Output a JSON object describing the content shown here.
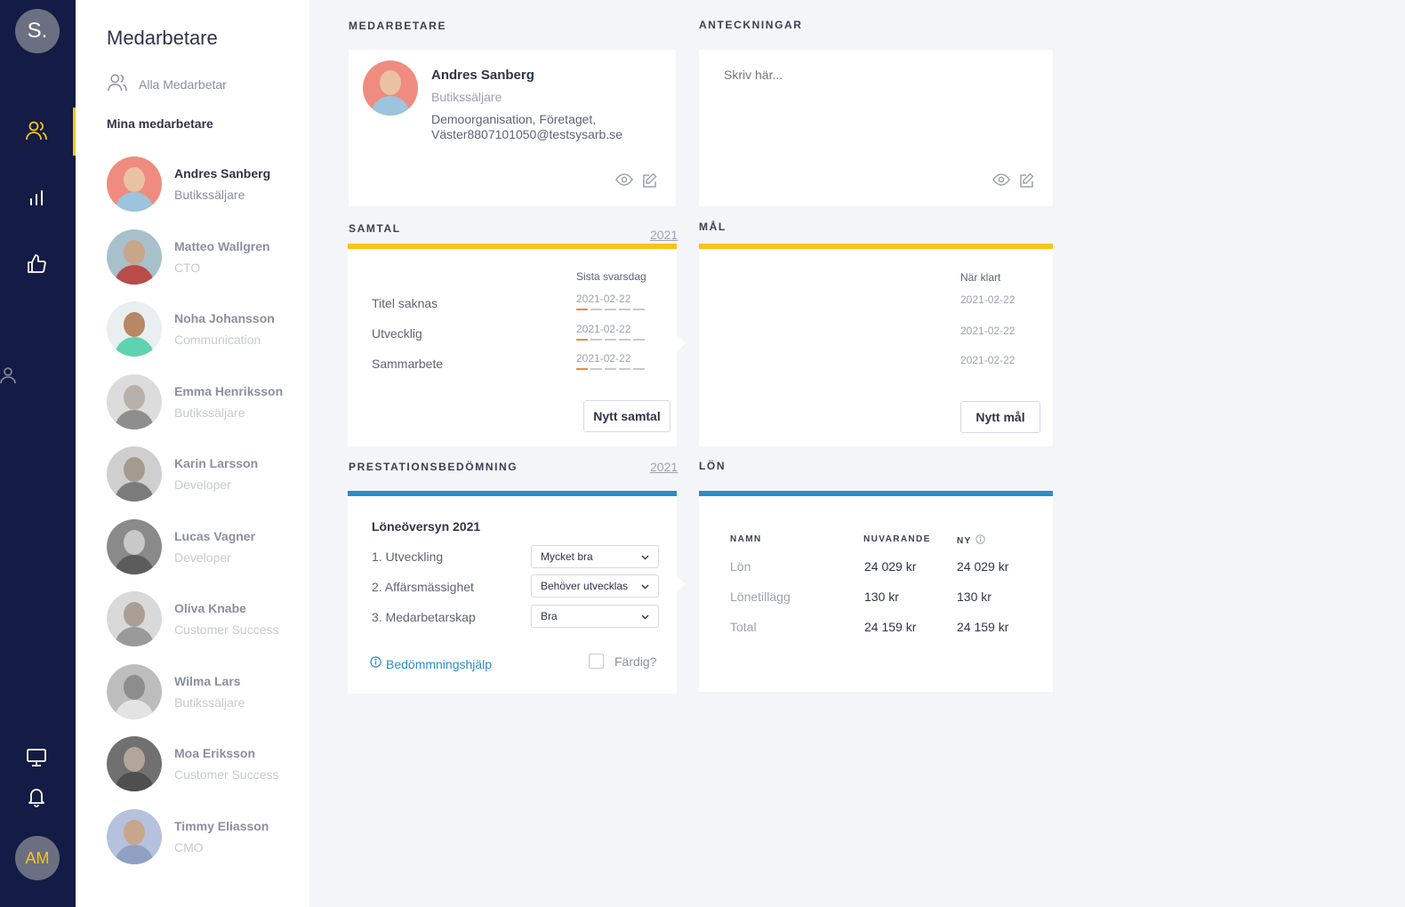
{
  "rail": {
    "logo": "S.",
    "user_initials": "AM",
    "accent": "#f5c518",
    "background": "#141b44"
  },
  "list": {
    "heading": "Medarbetare",
    "all_link": "Alla Medarbetar",
    "mine": "Mina medarbetare",
    "employees": [
      {
        "name": "Andres Sanberg",
        "role": "Butikssäljare"
      },
      {
        "name": "Matteo Wallgren",
        "role": "CTO"
      },
      {
        "name": "Noha Johansson",
        "role": "Communication"
      },
      {
        "name": "Emma Henriksson",
        "role": "Butikssäljare"
      },
      {
        "name": "Karin Larsson",
        "role": "Developer"
      },
      {
        "name": "Lucas Vagner",
        "role": "Developer"
      },
      {
        "name": "Oliva Knabe",
        "role": "Customer Success"
      },
      {
        "name": "Wilma Lars",
        "role": "Butikssäljare"
      },
      {
        "name": "Moa Eriksson",
        "role": "Customer Success"
      },
      {
        "name": "Timmy Eliasson",
        "role": "CMO"
      }
    ]
  },
  "profile": {
    "section": "MEDARBETARE",
    "name": "Andres Sanberg",
    "role": "Butikssäljare",
    "org": "Demoorganisation, Företaget, Väster8807101050@testsysarb.se"
  },
  "notes": {
    "section": "ANTECKNINGAR",
    "placeholder": "Skriv här..."
  },
  "samtal": {
    "section": "SAMTAL",
    "year": "2021",
    "date_header": "Sista svarsdag",
    "rows": [
      {
        "title": "Titel saknas",
        "date": "2021-02-22"
      },
      {
        "title": "Utvecklig",
        "date": "2021-02-22"
      },
      {
        "title": "Sammarbete",
        "date": "2021-02-22"
      }
    ],
    "button": "Nytt samtal"
  },
  "mal": {
    "section": "MÅL",
    "date_header": "När klart",
    "dates": [
      "2021-02-22",
      "2021-02-22",
      "2021-02-22"
    ],
    "button": "Nytt mål"
  },
  "prestation": {
    "section": "PRESTATIONSBEDÖMNING",
    "year": "2021",
    "title": "Löneöversyn 2021",
    "items": [
      {
        "label": "1. Utveckling",
        "value": "Mycket bra"
      },
      {
        "label": "2. Affärsmässighet",
        "value": "Behöver utvecklas"
      },
      {
        "label": "3. Medarbetarskap",
        "value": "Bra"
      }
    ],
    "help_link": "Bedömmningshjälp",
    "done_label": "Färdig?"
  },
  "lon": {
    "section": "LÖN",
    "headers": {
      "name": "NAMN",
      "current": "NUVARANDE",
      "new": "NY"
    },
    "rows": [
      {
        "name": "Lön",
        "current": "24 029 kr",
        "new": "24 029 kr"
      },
      {
        "name": "Lönetillägg",
        "current": "130 kr",
        "new": "130 kr"
      },
      {
        "name": "Total",
        "current": "24 159 kr",
        "new": "24 159 kr"
      }
    ]
  }
}
